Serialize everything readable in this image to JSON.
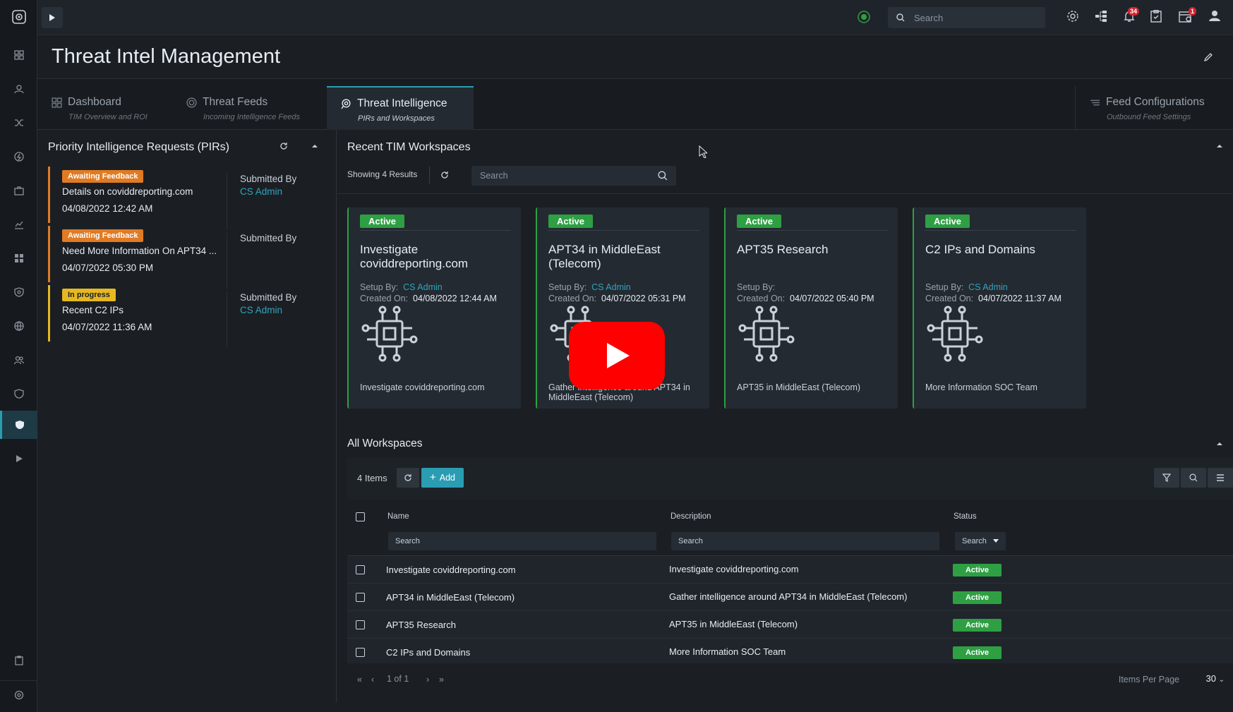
{
  "topbar": {
    "search_placeholder": "Search",
    "notifications_count": "34",
    "alerts_count": "1"
  },
  "page": {
    "title": "Threat Intel Management"
  },
  "tabs": [
    {
      "label": "Dashboard",
      "sub": "TIM Overview and ROI",
      "icon": "dashboard-icon"
    },
    {
      "label": "Threat Feeds",
      "sub": "Incoming Intelligence Feeds",
      "icon": "feed-icon"
    },
    {
      "label": "Threat Intelligence",
      "sub": "PIRs and Workspaces",
      "icon": "intel-icon",
      "active": true
    },
    {
      "label": "Feed Configurations",
      "sub": "Outbound Feed Settings",
      "icon": "config-icon"
    }
  ],
  "pir_panel": {
    "title": "Priority Intelligence Requests (PIRs)",
    "items": [
      {
        "badge": "Awaiting Feedback",
        "name": "Details on coviddreporting.com",
        "date": "04/08/2022 12:42 AM",
        "submitted_label": "Submitted By",
        "submitted_by": "CS Admin"
      },
      {
        "badge": "Awaiting Feedback",
        "name": "Need More Information On APT34 ...",
        "date": "04/07/2022 05:30 PM",
        "submitted_label": "Submitted By",
        "submitted_by": ""
      },
      {
        "badge": "In progress",
        "name": "Recent C2 IPs",
        "date": "04/07/2022 11:36 AM",
        "submitted_label": "Submitted By",
        "submitted_by": "CS Admin"
      }
    ]
  },
  "recent": {
    "title": "Recent TIM Workspaces",
    "results": "Showing 4 Results",
    "search_placeholder": "Search",
    "cards": [
      {
        "status": "Active",
        "title": "Investigate coviddreporting.com",
        "setup_label": "Setup By:",
        "setup_by": "CS Admin",
        "created_label": "Created On:",
        "created": "04/08/2022 12:44 AM",
        "desc": "Investigate coviddreporting.com"
      },
      {
        "status": "Active",
        "title": "APT34 in MiddleEast (Telecom)",
        "setup_label": "Setup By:",
        "setup_by": "CS Admin",
        "created_label": "Created On:",
        "created": "04/07/2022 05:31 PM",
        "desc": "Gather intelligence around APT34 in MiddleEast (Telecom)"
      },
      {
        "status": "Active",
        "title": "APT35 Research",
        "setup_label": "Setup By:",
        "setup_by": "",
        "created_label": "Created On:",
        "created": "04/07/2022 05:40 PM",
        "desc": "APT35 in MiddleEast (Telecom)"
      },
      {
        "status": "Active",
        "title": "C2 IPs and Domains",
        "setup_label": "Setup By:",
        "setup_by": "CS Admin",
        "created_label": "Created On:",
        "created": "04/07/2022 11:37 AM",
        "desc": "More Information SOC Team"
      }
    ]
  },
  "all": {
    "title": "All Workspaces",
    "count": "4 Items",
    "add_label": "Add",
    "columns": {
      "name": "Name",
      "description": "Description",
      "status": "Status"
    },
    "filters": {
      "name": "Search",
      "description": "Search",
      "status": "Search"
    },
    "rows": [
      {
        "name": "Investigate coviddreporting.com",
        "description": "Investigate coviddreporting.com",
        "status": "Active"
      },
      {
        "name": "APT34 in MiddleEast (Telecom)",
        "description": "Gather intelligence around APT34 in MiddleEast (Telecom)",
        "status": "Active"
      },
      {
        "name": "APT35 Research",
        "description": "APT35 in MiddleEast (Telecom)",
        "status": "Active"
      },
      {
        "name": "C2 IPs and Domains",
        "description": "More Information SOC Team",
        "status": "Active"
      }
    ],
    "pager": {
      "page_text": "1 of 1",
      "per_page_label": "Items Per Page",
      "per_page": "30"
    }
  },
  "colors": {
    "accent": "#2a9db3",
    "active": "#2ea043",
    "awaiting": "#e07b24",
    "in_progress": "#e6b821"
  }
}
